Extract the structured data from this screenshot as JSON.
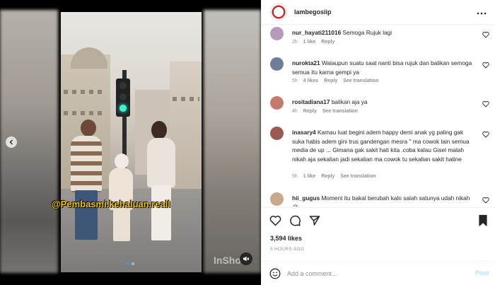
{
  "media": {
    "watermark_text": "@Pembasmi.kehaluan.reall",
    "brand_text": "InShot",
    "slide_count": 2,
    "active_slide": 1
  },
  "post": {
    "username": "lambegosiip",
    "more_icon": "more-horizontal-icon"
  },
  "comments": [
    {
      "username": "nur_hayati211016",
      "text": "Semoga Rujuk lagi",
      "time": "2h",
      "likes": "1 like",
      "reply": "Reply",
      "translation": "",
      "avatar_color": "#b79ab9"
    },
    {
      "username": "nurokta21",
      "text": "Walaupun suatu saat nanti bisa rujuk dan balikan semoga semua itu karna gempi ya",
      "time": "5h",
      "likes": "4 likes",
      "reply": "Reply",
      "translation": "See translation",
      "avatar_color": "#6f7e96"
    },
    {
      "username": "rositadiana17",
      "text": "balikan aja ya",
      "time": "4h",
      "likes": "",
      "reply": "Reply",
      "translation": "See translation",
      "avatar_color": "#c47b6b"
    },
    {
      "username": "inasary4",
      "text": "Kamau luat begini adem happy demi anak yg paling gak suka habis adem gini trus gandengan mesra \" ma cowok lain semua media de up ... Gimana gak sakit hati kita .coba kalau Gisel malah nikah aja sekalian jadi sekalian ma cowok tu sekalian sakit hatine",
      "time": "5h",
      "likes": "1 like",
      "reply": "Reply",
      "translation": "See translation",
      "avatar_color": "#9a5a52"
    },
    {
      "username": "hii_gugus",
      "text": "Moment itu bakal berubah kalo salah satunya udah nikah😂",
      "time": "",
      "likes": "",
      "reply": "",
      "translation": "",
      "avatar_color": "#c9a98c"
    }
  ],
  "actions": {
    "likes_count": "3,594 likes",
    "date": "5 HOURS AGO",
    "add_comment_placeholder": "Add a comment...",
    "post_label": "Post"
  },
  "colors": {
    "link_blue": "#3897f0",
    "post_disabled": "#b2dffc",
    "watermark_yellow": "#f2c300"
  }
}
